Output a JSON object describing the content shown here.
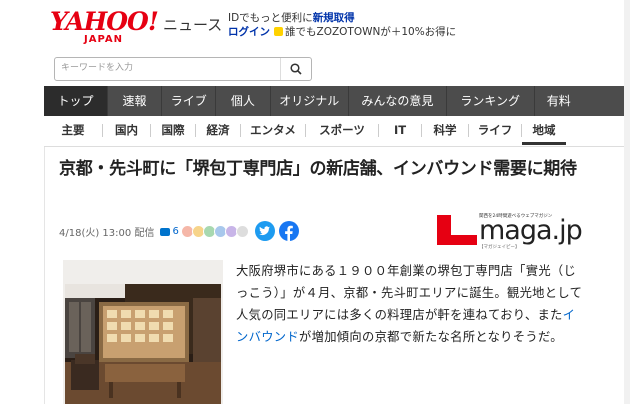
{
  "header": {
    "logo_text": "YAHOO!",
    "logo_sub": "JAPAN",
    "service_name": "ニュース",
    "promo_line1_prefix": "IDでもっと便利に",
    "promo_line1_link": "新規取得",
    "login_label": "ログイン",
    "promo_line2": "誰でもZOZOTOWNが＋10%お得に"
  },
  "search": {
    "placeholder": "キーワードを入力"
  },
  "main_nav": [
    "トップ",
    "速報",
    "ライブ",
    "個人",
    "オリジナル",
    "みんなの意見",
    "ランキング",
    "有料"
  ],
  "sub_nav": [
    "主要",
    "国内",
    "国際",
    "経済",
    "エンタメ",
    "スポーツ",
    "IT",
    "科学",
    "ライフ",
    "地域"
  ],
  "article": {
    "headline": "京都・先斗町に「堺包丁専門店」の新店舗、インバウンド需要に期待",
    "date": "4/18(火) 13:00",
    "posted_label": "配信",
    "comment_count": "6",
    "source_logo": "maga.jp",
    "source_tagline": "関西を24時間遊べるウェブマガジン",
    "source_caption": "【マガジェイピー】",
    "body_part1": "大阪府堺市にある１９００年創業の堺包丁専門店「實光（じっこう）」が４月、京都・先斗町エリアに誕生。観光地として人気の同エリアには多くの料理店が軒を連ねており、また",
    "body_link": "インバウンド",
    "body_part2": "が増加傾向の京都で新たな名所となりそうだ。"
  },
  "colors": {
    "brand_red": "#e60012",
    "nav_bg": "#4c4c4c",
    "link_blue": "#0066cc"
  }
}
